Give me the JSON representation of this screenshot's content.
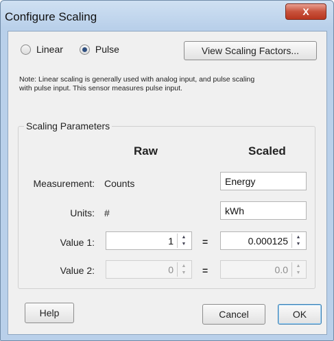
{
  "window": {
    "title": "Configure Scaling",
    "close_glyph": "X"
  },
  "mode": {
    "options": [
      {
        "label": "Linear",
        "checked": false
      },
      {
        "label": "Pulse",
        "checked": true
      }
    ],
    "view_factors_label": "View Scaling Factors..."
  },
  "note": "Note: Linear scaling is generally used with analog input, and pulse scaling with pulse input. This sensor measures pulse input.",
  "params": {
    "group_title": "Scaling Parameters",
    "raw_header": "Raw",
    "scaled_header": "Scaled",
    "measurement_label": "Measurement:",
    "measurement_raw": "Counts",
    "measurement_scaled": "Energy",
    "units_label": "Units:",
    "units_raw": "#",
    "units_scaled": "kWh",
    "value1_label": "Value 1:",
    "value1_raw": "1",
    "value1_scaled": "0.000125",
    "value2_label": "Value 2:",
    "value2_raw": "0",
    "value2_scaled": "0.0",
    "equals": "="
  },
  "buttons": {
    "help": "Help",
    "cancel": "Cancel",
    "ok": "OK"
  }
}
